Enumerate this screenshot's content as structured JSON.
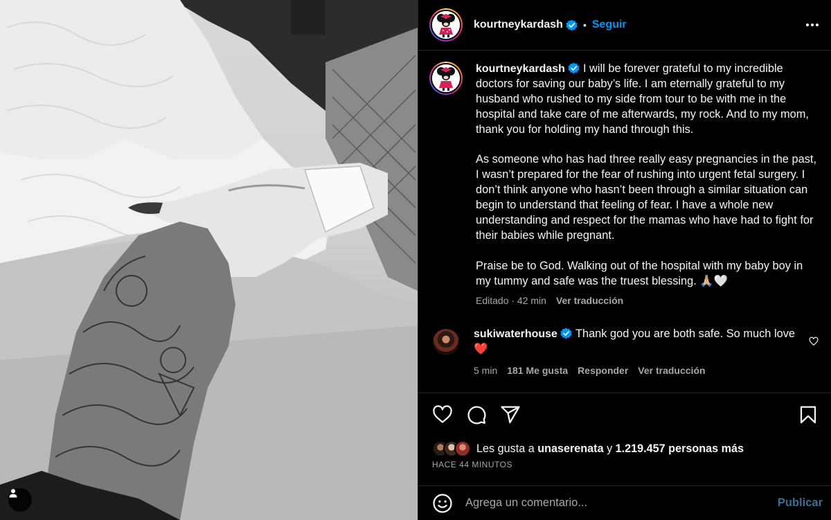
{
  "header": {
    "username": "kourtneykardash",
    "separator": "•",
    "follow_label": "Seguir"
  },
  "caption": {
    "username": "kourtneykardash",
    "text": "I will be forever grateful to my incredible doctors for saving our baby’s life. I am eternally grateful to my husband who rushed to my side from tour to be with me in the hospital and take care of me afterwards, my rock. And to my mom, thank you for holding my hand through this.\n\nAs someone who has had three really easy pregnancies in the past, I wasn’t prepared for the fear of rushing into urgent fetal surgery. I don’t think anyone who hasn’t been through a similar situation can begin to understand that feeling of fear. I have a whole new understanding and respect for the mamas who have had to fight for their babies while pregnant.\n\nPraise be to God. Walking out of the hospital with my baby boy in my tummy and safe was the truest blessing. 🙏🏼🤍",
    "edited_time": "Editado · 42 min",
    "translate_label": "Ver traducción"
  },
  "comment": {
    "username": "sukiwaterhouse",
    "text": "Thank god you are both safe. So much love ❤️",
    "time": "5 min",
    "likes": "181 Me gusta",
    "reply_label": "Responder",
    "translate_label": "Ver traducción"
  },
  "likes": {
    "prefix": "Les gusta a",
    "user": "unaserenata",
    "conjunction": "y",
    "count_text": "1.219.457 personas más",
    "time_ago": "HACE 44 MINUTOS"
  },
  "comment_box": {
    "placeholder": "Agrega un comentario...",
    "publish_label": "Publicar"
  },
  "icons": {
    "verified": "verified-badge-icon",
    "more": "more-options-icon",
    "like": "heart-icon",
    "comment": "comment-icon",
    "share": "share-icon",
    "save": "bookmark-icon",
    "emoji": "emoji-icon",
    "user_tag": "user-tag-icon"
  },
  "colors": {
    "accent": "#0095f6",
    "background": "#000000",
    "secondary_text": "#a8a8a8",
    "publish_disabled": "#3d6e93"
  }
}
